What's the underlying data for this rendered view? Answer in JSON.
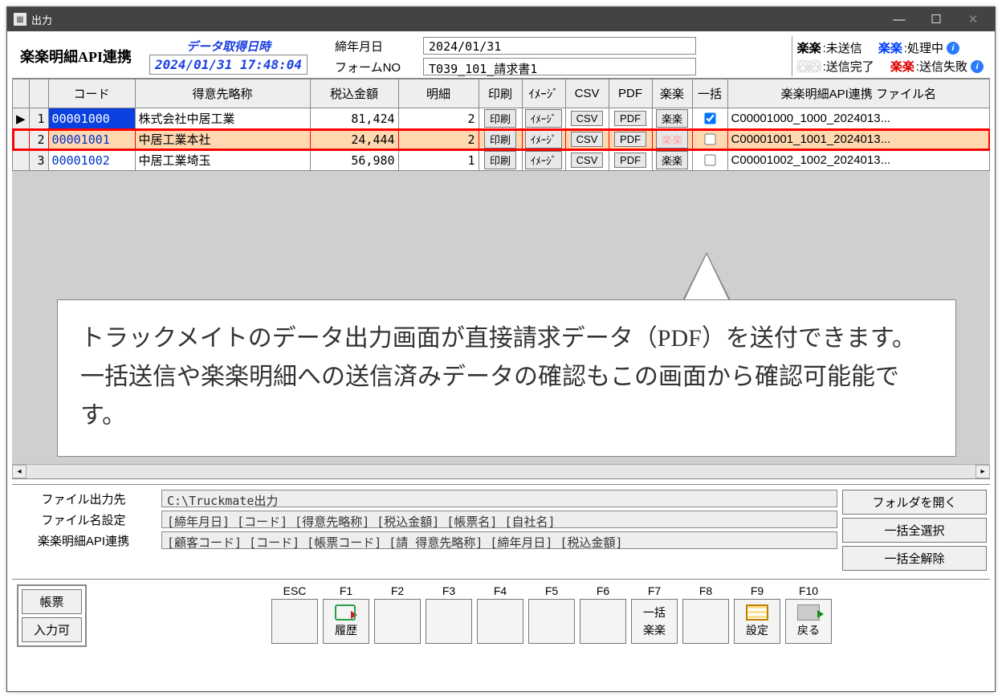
{
  "titlebar": {
    "title": "出力"
  },
  "header": {
    "app_title": "楽楽明細API連携",
    "dt_label": "データ取得日時",
    "dt_value": "2024/01/31 17:48:04",
    "closed_ym_label": "締年月日",
    "closed_ym_value": "2024/01/31",
    "form_no_label": "フォームNO",
    "form_no_value": "T039_101_請求書1"
  },
  "legend": {
    "unsent_k": "楽楽",
    "unsent_v": ":未送信",
    "processing_k": "楽楽",
    "processing_v": ":処理中",
    "done_k": "楽楽",
    "done_v": ":送信完了",
    "fail_k": "楽楽",
    "fail_v": ":送信失敗"
  },
  "grid": {
    "headers": {
      "code": "コード",
      "name": "得意先略称",
      "amount": "税込金額",
      "detail": "明細",
      "print": "印刷",
      "image": "ｲﾒｰｼﾞ",
      "csv": "CSV",
      "pdf": "PDF",
      "rakuraku": "楽楽",
      "batch": "一括",
      "filename": "楽楽明細API連携 ファイル名"
    },
    "btn": {
      "print": "印刷",
      "image": "ｲﾒｰｼﾞ",
      "csv": "CSV",
      "pdf": "PDF",
      "rakuraku": "楽楽"
    },
    "rows": [
      {
        "idx": "1",
        "code": "00001000",
        "name": "株式会社中居工業",
        "amount": "81,424",
        "detail": "2",
        "batch": true,
        "file": "C00001000_1000_2024013..."
      },
      {
        "idx": "2",
        "code": "00001001",
        "name": "中居工業本社",
        "amount": "24,444",
        "detail": "2",
        "batch": false,
        "file": "C00001001_1001_2024013..."
      },
      {
        "idx": "3",
        "code": "00001002",
        "name": "中居工業埼玉",
        "amount": "56,980",
        "detail": "1",
        "batch": false,
        "file": "C00001002_1002_2024013..."
      }
    ]
  },
  "callout": "トラックメイトのデータ出力画面が直接請求データ（PDF）を送付できます。一括送信や楽楽明細への送信済みデータの確認もこの画面から確認可能能です。",
  "settings": {
    "out_label": "ファイル出力先",
    "out_value": "C:\\Truckmate出力",
    "fname_label": "ファイル名設定",
    "fname_value": "[締年月日]_[コード]_[得意先略称]_[税込金額]_[帳票名]_[自社名]",
    "link_label": "楽楽明細API連携",
    "link_value": "[顧客コード]_[コード]_[帳票コード]_[請 得意先略称]_[締年月日]_[税込金額]",
    "open_folder": "フォルダを開く",
    "select_all": "一括全選択",
    "deselect_all": "一括全解除"
  },
  "fkeys": {
    "left": {
      "report": "帳票",
      "editable": "入力可"
    },
    "esc": "ESC",
    "f1": "F1",
    "f2": "F2",
    "f3": "F3",
    "f4": "F4",
    "f5": "F5",
    "f6": "F6",
    "f7": "F7",
    "f8": "F8",
    "f9": "F9",
    "f10": "F10",
    "f1_label": "履歴",
    "f7_label1": "一括",
    "f7_label2": "楽楽",
    "f9_label": "設定",
    "f10_label": "戻る"
  }
}
